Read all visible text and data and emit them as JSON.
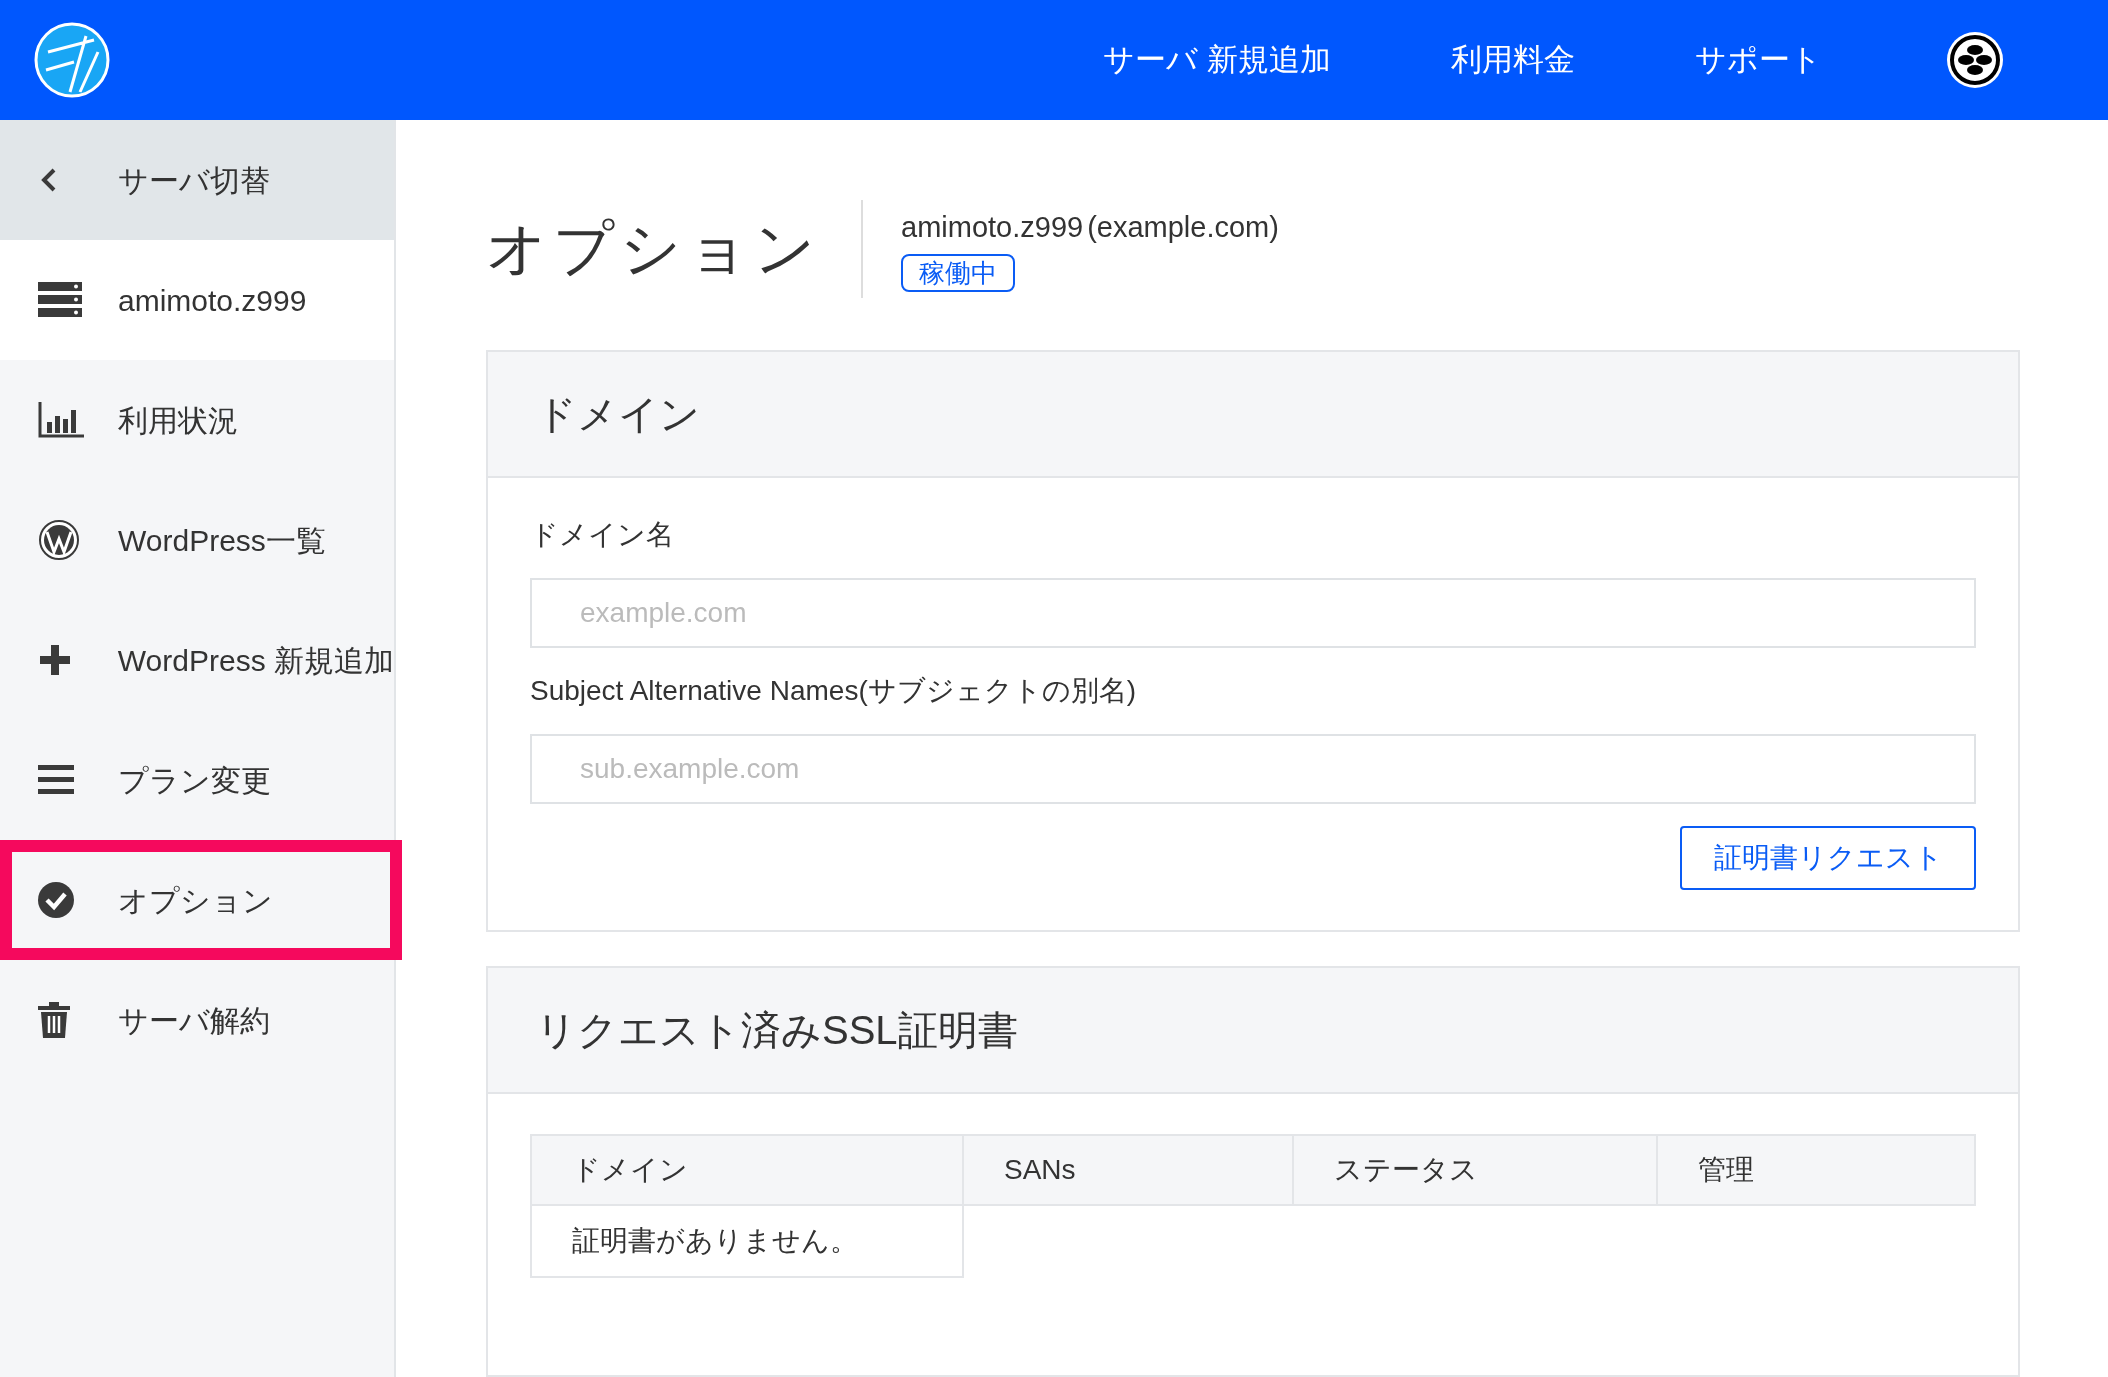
{
  "header": {
    "nav": [
      "サーバ 新規追加",
      "利用料金",
      "サポート"
    ]
  },
  "sidebar": {
    "items": [
      {
        "kind": "back",
        "label": "サーバ切替",
        "selected": false
      },
      {
        "kind": "server",
        "label": "amimoto.z999",
        "selected": false
      },
      {
        "kind": "chart",
        "label": "利用状況",
        "selected": false
      },
      {
        "kind": "wordpress",
        "label": "WordPress一覧",
        "selected": false
      },
      {
        "kind": "plus",
        "label": "WordPress 新規追加",
        "selected": false
      },
      {
        "kind": "menu",
        "label": "プラン変更",
        "selected": false
      },
      {
        "kind": "check",
        "label": "オプション",
        "selected": true
      },
      {
        "kind": "trash",
        "label": "サーバ解約",
        "selected": false
      }
    ]
  },
  "page": {
    "title": "オプション",
    "server": "amimoto.z999",
    "domain": "(example.com)",
    "status": "稼働中"
  },
  "domain_card": {
    "title": "ドメイン",
    "fields": [
      {
        "label": "ドメイン名",
        "placeholder": "example.com"
      },
      {
        "label": "Subject Alternative Names(サブジェクトの別名)",
        "placeholder": "sub.example.com"
      }
    ],
    "button": "証明書リクエスト"
  },
  "ssl_card": {
    "title": "リクエスト済みSSL証明書",
    "table": {
      "columns": [
        "ドメイン",
        "SANs",
        "ステータス",
        "管理"
      ],
      "empty": "証明書がありません。"
    }
  }
}
